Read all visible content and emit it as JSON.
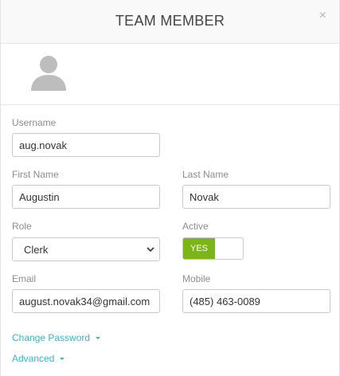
{
  "header": {
    "title": "TEAM MEMBER",
    "close_glyph": "×"
  },
  "avatar": {
    "icon": "user-avatar-icon"
  },
  "form": {
    "username": {
      "label": "Username",
      "value": "aug.novak"
    },
    "first_name": {
      "label": "First Name",
      "value": "Augustin"
    },
    "last_name": {
      "label": "Last Name",
      "value": "Novak"
    },
    "role": {
      "label": "Role",
      "value": "Clerk"
    },
    "active": {
      "label": "Active",
      "state_label": "YES",
      "on": true,
      "color": "#7cb518"
    },
    "email": {
      "label": "Email",
      "value": "august.novak34@gmail.com"
    },
    "mobile": {
      "label": "Mobile",
      "value": "(485) 463-0089"
    }
  },
  "links": {
    "change_password": "Change Password",
    "advanced": "Advanced",
    "color": "#3bb4c1"
  }
}
